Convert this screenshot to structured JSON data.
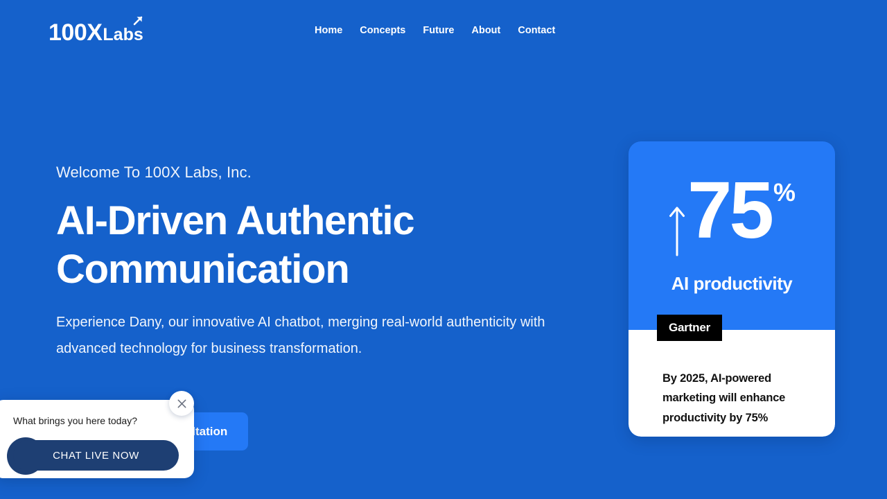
{
  "brand": {
    "logo_primary": "100X",
    "logo_secondary": "Labs",
    "arrow_icon": "arrow-up-right-icon"
  },
  "nav": {
    "items": [
      {
        "label": "Home"
      },
      {
        "label": "Concepts"
      },
      {
        "label": "Future"
      },
      {
        "label": "About"
      },
      {
        "label": "Contact"
      }
    ]
  },
  "hero": {
    "eyebrow": "Welcome To 100X Labs, Inc.",
    "headline": "AI-Driven Authentic Communication",
    "subcopy": "Experience Dany, our innovative AI chatbot, merging real-world authenticity with advanced technology for business transformation.",
    "cta_label": "Book a Consultation"
  },
  "stat_card": {
    "trend_icon": "arrow-up-icon",
    "value": "75",
    "unit": "%",
    "label": "AI productivity",
    "source": "Gartner",
    "quote": "By 2025, AI-powered marketing will enhance productivity by 75%"
  },
  "chat_widget": {
    "prompt": "What brings you here today?",
    "button_label": "CHAT LIVE NOW",
    "close_icon": "close-icon",
    "avatar_icon": "avatar"
  },
  "colors": {
    "page_background": "#1561cb",
    "card_blue": "#2479f6",
    "chat_navy": "#1e3f73",
    "source_tag": "#000000",
    "surface_white": "#ffffff"
  }
}
